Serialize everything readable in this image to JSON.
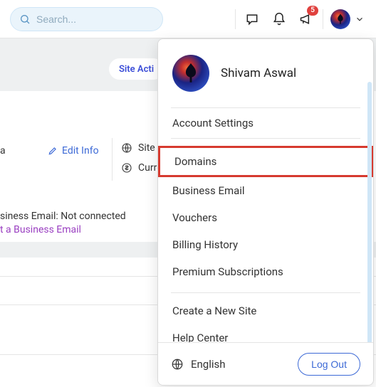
{
  "search": {
    "placeholder": "Search..."
  },
  "notifications": {
    "badge": "5"
  },
  "bg": {
    "siteActions": "Site Acti",
    "editInfo": "Edit Info",
    "siteLang": "Site la",
    "currency": "Curre",
    "a": "a",
    "bemail": "siness Email: Not connected",
    "bemailLink": "t a Business Email"
  },
  "menu": {
    "user": "Shivam Aswal",
    "accountSettings": "Account Settings",
    "items": [
      "Domains",
      "Business Email",
      "Vouchers",
      "Billing History",
      "Premium Subscriptions"
    ],
    "create": "Create a New Site",
    "help": "Help Center",
    "language": "English",
    "logout": "Log Out"
  }
}
